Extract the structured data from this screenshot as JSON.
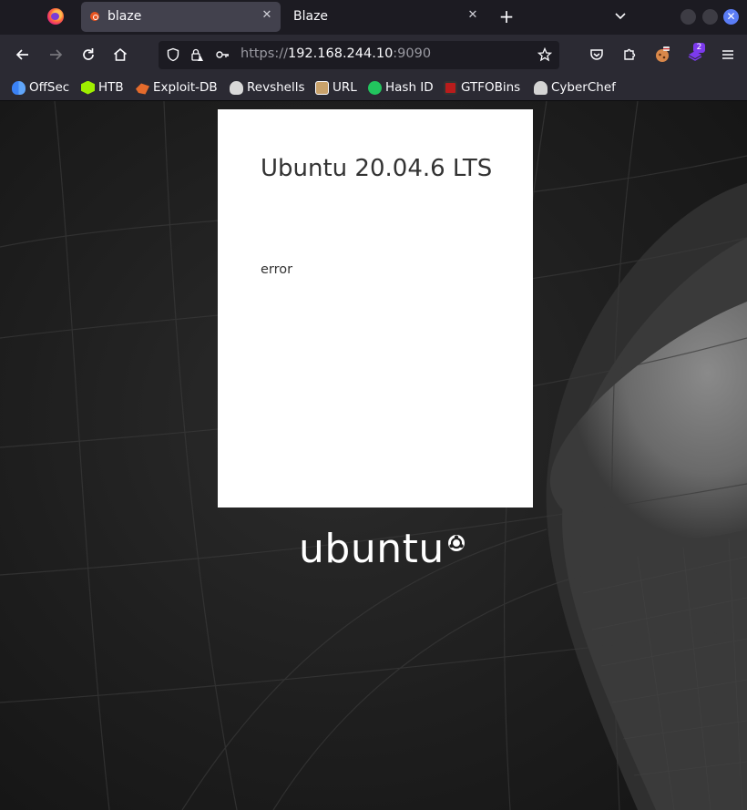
{
  "browser": {
    "tabs": [
      {
        "title": "blaze",
        "active": true,
        "close_icon": "close-icon"
      },
      {
        "title": "Blaze",
        "active": false,
        "close_icon": "close-icon"
      }
    ],
    "new_tab_symbol": "+",
    "url": {
      "scheme": "https://",
      "host": "192.168.244.10",
      "port": ":9090"
    },
    "extension_badge": "2",
    "bookmarks": [
      {
        "label": "OffSec",
        "icon": "offsec-icon",
        "color": "#3b82f6"
      },
      {
        "label": "HTB",
        "icon": "htb-icon",
        "color": "#9fef00"
      },
      {
        "label": "Exploit-DB",
        "icon": "exploitdb-icon",
        "color": "#e56b2c"
      },
      {
        "label": "Revshells",
        "icon": "skull-icon",
        "color": "#d9d9d9"
      },
      {
        "label": "URL",
        "icon": "url-icon",
        "color": "#c9a26b"
      },
      {
        "label": "Hash ID",
        "icon": "hashid-icon",
        "color": "#22c55e"
      },
      {
        "label": "GTFOBins",
        "icon": "gtfobins-icon",
        "color": "#b91c1c"
      },
      {
        "label": "CyberChef",
        "icon": "cyberchef-icon",
        "color": "#d4d4d4"
      }
    ]
  },
  "login": {
    "title": "Ubuntu 20.04.6 LTS",
    "message": "error"
  },
  "brand": {
    "wordmark": "ubuntu"
  }
}
